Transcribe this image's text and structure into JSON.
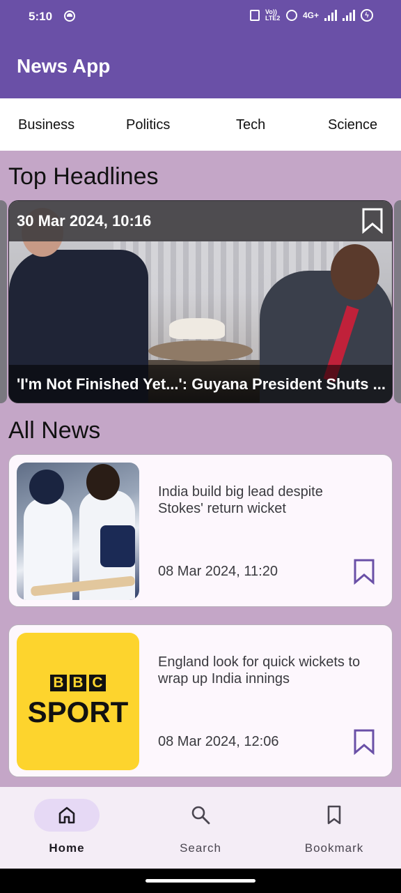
{
  "status_bar": {
    "time": "5:10",
    "network": "4G+",
    "volte": "Vo)) LTE2"
  },
  "app": {
    "title": "News App"
  },
  "categories": [
    "Business",
    "Politics",
    "Tech",
    "Science"
  ],
  "sections": {
    "top_headlines": "Top Headlines",
    "all_news": "All News"
  },
  "headline": {
    "date": "30 Mar 2024, 10:16",
    "title": "'I'm Not Finished Yet...': Guyana President Shuts ..."
  },
  "news": [
    {
      "title": "India build big lead despite Stokes' return wicket",
      "date": "08 Mar 2024, 11:20",
      "image": "cricket-photo"
    },
    {
      "title": "England look for quick wickets to wrap up India innings",
      "date": "08 Mar 2024, 12:06",
      "image": "bbc-sport-logo"
    }
  ],
  "bbc_logo": {
    "letters": [
      "B",
      "B",
      "C"
    ],
    "word": "SPORT"
  },
  "bottom_nav": [
    {
      "label": "Home",
      "icon": "home-icon",
      "active": true
    },
    {
      "label": "Search",
      "icon": "search-icon",
      "active": false
    },
    {
      "label": "Bookmark",
      "icon": "bookmark-icon",
      "active": false
    }
  ],
  "colors": {
    "primary": "#6a50a7",
    "background": "#c4a6c7",
    "card": "#fdf7fd",
    "nav_pill": "#e6d9f5",
    "bbc_yellow": "#fdd42d"
  }
}
